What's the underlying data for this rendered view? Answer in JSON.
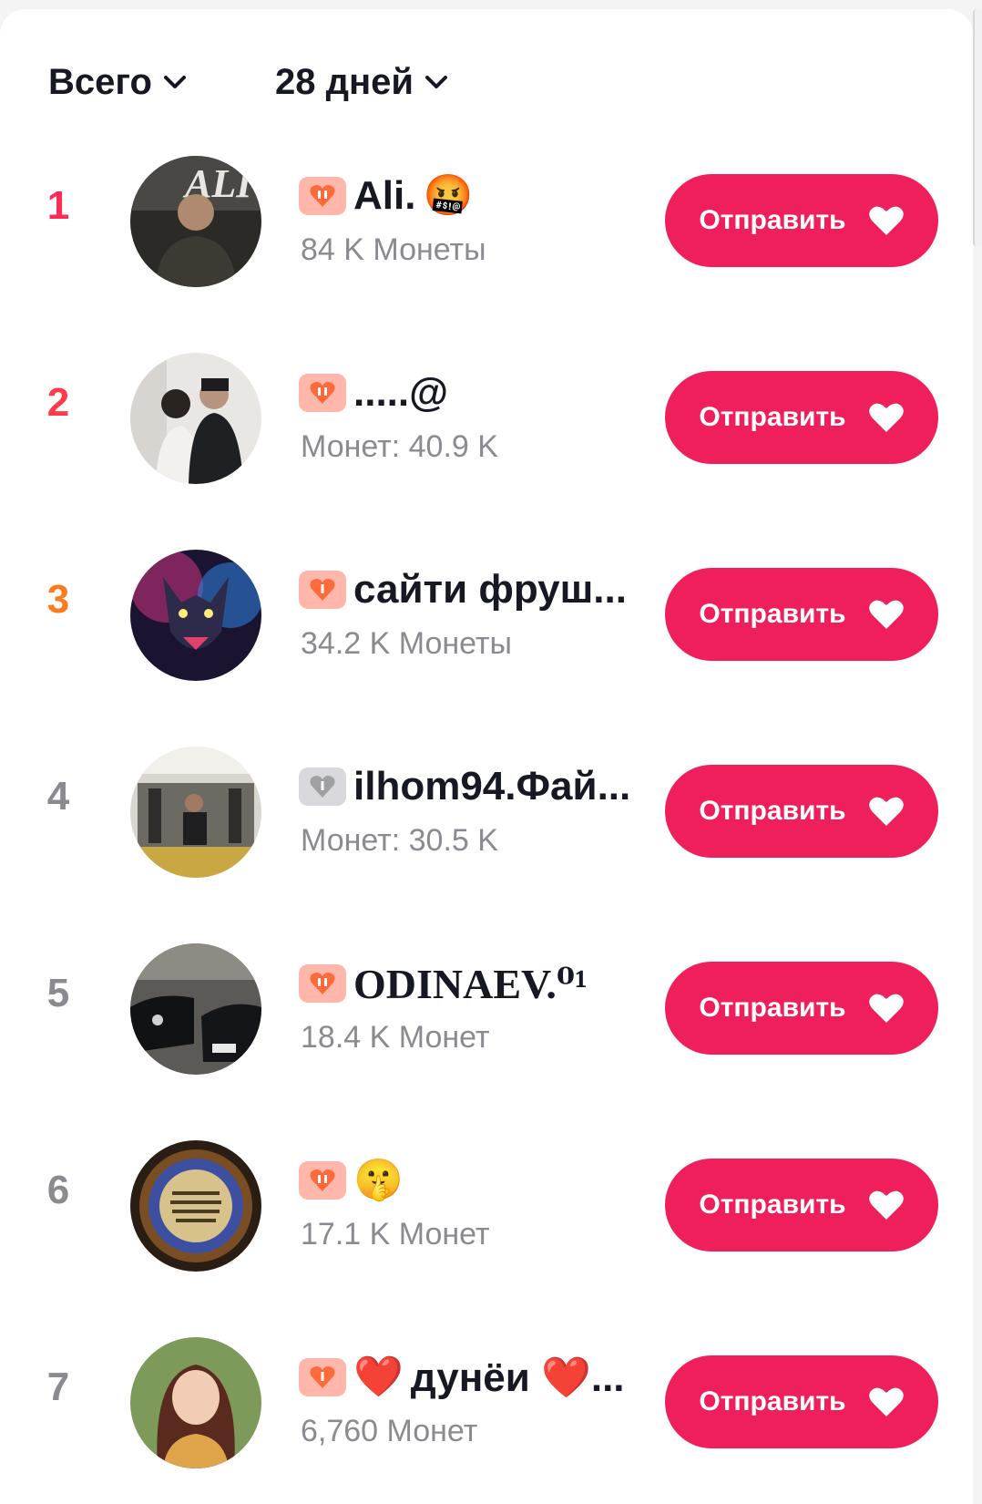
{
  "filters": {
    "scope": {
      "label": "Всего",
      "icon": "chevron-down-icon"
    },
    "period": {
      "label": "28 дней",
      "icon": "chevron-down-icon"
    }
  },
  "send_label": "Отправить",
  "send_icon": "heart-icon",
  "accent": "#ef1f5c",
  "ranking": [
    {
      "rank": "1",
      "name": "Ali.",
      "name_suffix_emoji": "🤬",
      "coins": "84 K Монеты",
      "badge_icon": "level-badge-icon"
    },
    {
      "rank": "2",
      "name": ".....@",
      "coins": "Монет: 40.9 K",
      "badge_icon": "level-badge-icon"
    },
    {
      "rank": "3",
      "name": "сайти фруш...",
      "coins": "34.2 K Монеты",
      "badge_icon": "level-badge-icon"
    },
    {
      "rank": "4",
      "name": "ilhom94.Фай...",
      "coins": "Монет: 30.5 K",
      "badge_icon": "level-badge-gray-icon"
    },
    {
      "rank": "5",
      "name": "ODINAEV.⁰¹",
      "coins": "18.4 K Монет",
      "badge_icon": "level-badge-icon"
    },
    {
      "rank": "6",
      "name": "",
      "name_suffix_emoji": "🤫",
      "coins": "17.1 K Монет",
      "badge_icon": "level-badge-icon"
    },
    {
      "rank": "7",
      "name_prefix_emoji": "❤️",
      "name": "дунёи ❤️...",
      "coins": "6,760 Монет",
      "badge_icon": "level-badge-icon"
    }
  ]
}
